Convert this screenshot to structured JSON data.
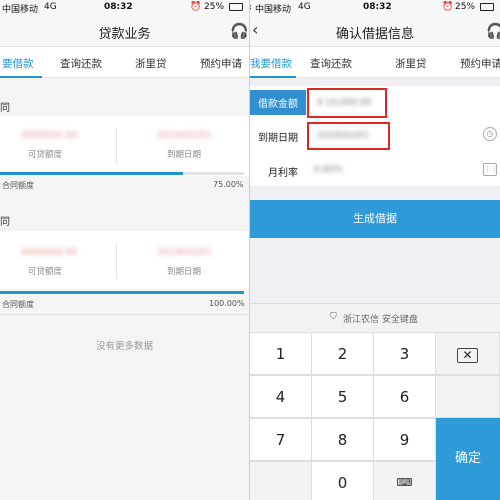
{
  "left": {
    "status": {
      "carrier": "中国移动",
      "network": "4G",
      "time": "08:32",
      "battery": "25%"
    },
    "title": "贷款业务",
    "tabs": [
      "要借款",
      "查询还款",
      "浙里贷",
      "预约申请"
    ],
    "active_tab_index": 0,
    "contracts": [
      {
        "section_title": "同",
        "available_value": "3000000.00",
        "available_label": "可贷额度",
        "due_value": "2019/02/01",
        "due_label": "到期日期",
        "used_label": "合同额度",
        "used_percent_text": "75.00%",
        "used_fraction": 0.75
      },
      {
        "section_title": "同",
        "available_value": "3000000.00",
        "available_label": "可贷额度",
        "due_value": "2019/02/01",
        "due_label": "到期日期",
        "used_label": "合同额度",
        "used_percent_text": "100.00%",
        "used_fraction": 1.0
      }
    ],
    "no_more_text": "没有更多数据"
  },
  "right": {
    "status": {
      "carrier": "中国移动",
      "network": "4G",
      "time": "08:32",
      "battery": "25%"
    },
    "title": "确认借据信息",
    "tabs": [
      "我要借款",
      "查询还款",
      "浙里贷",
      "预约申请"
    ],
    "active_tab_index": 0,
    "form": {
      "amount_label": "借款金额",
      "amount_value": "¥ 10,000.00",
      "due_label": "到期日期",
      "due_value": "2019/02/01",
      "rate_label": "月利率",
      "rate_value": "0.60%"
    },
    "generate_button": "生成借据",
    "keyboard": {
      "title": "浙江农信  安全键盘",
      "keys": [
        "1",
        "2",
        "3",
        "4",
        "5",
        "6",
        "7",
        "8",
        "9",
        "0"
      ],
      "confirm": "确定"
    }
  },
  "colors": {
    "accent": "#2f9ad8",
    "highlight_border": "#e02727"
  }
}
